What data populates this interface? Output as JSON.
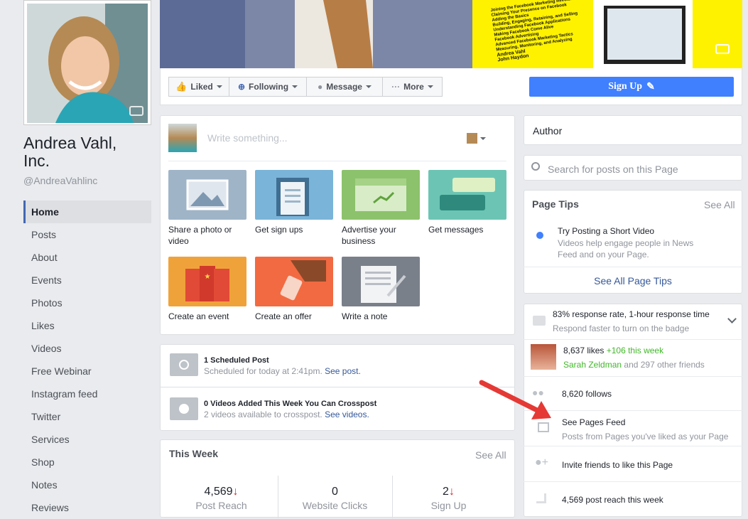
{
  "profile": {
    "name": "Andrea Vahl, Inc.",
    "name_line1": "Andrea Vahl,",
    "name_line2": "Inc.",
    "handle": "@AndreaVahlinc"
  },
  "nav": [
    "Home",
    "Posts",
    "About",
    "Events",
    "Photos",
    "Likes",
    "Videos",
    "Free Webinar",
    "Instagram feed",
    "Twitter",
    "Services",
    "Shop",
    "Notes",
    "Reviews"
  ],
  "actions": {
    "liked": "Liked",
    "following": "Following",
    "message": "Message",
    "more": "More",
    "signup": "Sign Up"
  },
  "cover_book_text": [
    "Joining the Facebook Marketing Revolution",
    "Claiming Your Presence on Facebook",
    "Adding the Basics",
    "Building, Engaging, Retaining, and Selling",
    "Understanding Facebook Applications",
    "Making Facebook Come Alive",
    "Facebook Advertising",
    "Advanced Facebook Marketing Tactics",
    "Measuring, Monitoring, and Analyzing",
    "Andrea Vahl",
    "John Haydon"
  ],
  "composer": {
    "placeholder": "Write something...",
    "tiles": [
      "Share a photo or video",
      "Get sign ups",
      "Advertise your business",
      "Get messages",
      "Create an event",
      "Create an offer",
      "Write a note"
    ]
  },
  "scheduled": {
    "title": "1 Scheduled Post",
    "desc": "Scheduled for today at 2:41pm.",
    "link": "See post."
  },
  "videos": {
    "title": "0 Videos Added This Week You Can Crosspost",
    "desc": "2 videos available to crosspost.",
    "link": "See videos."
  },
  "this_week": {
    "title": "This Week",
    "see_all": "See All",
    "stats": [
      {
        "value": "4,569",
        "label": "Post Reach",
        "down": true
      },
      {
        "value": "0",
        "label": "Website Clicks",
        "down": false
      },
      {
        "value": "2",
        "label": "Sign Up",
        "down": true
      }
    ]
  },
  "sidebar": {
    "author": "Author",
    "search_placeholder": "Search for posts on this Page",
    "tips": {
      "title": "Page Tips",
      "see_all": "See All",
      "tip_title": "Try Posting a Short Video",
      "tip_desc": "Videos help engage people in News Feed and on your Page.",
      "see_all_tips": "See All Page Tips"
    },
    "response": {
      "line1": "83% response rate, 1-hour response time",
      "line2": "Respond faster to turn on the badge"
    },
    "likes": {
      "count": "8,637 likes",
      "delta": "+106 this week",
      "friend": "Sarah Zeldman",
      "others": "and 297 other friends"
    },
    "follows": "8,620 follows",
    "feed": {
      "title": "See Pages Feed",
      "desc": "Posts from Pages you've liked as your Page"
    },
    "invite": "Invite friends to like this Page",
    "reach": "4,569 post reach this week"
  },
  "colors": {
    "accent": "#4267b2",
    "signup": "#4080ff",
    "arrow": "#e53935",
    "down": "#e02424"
  }
}
